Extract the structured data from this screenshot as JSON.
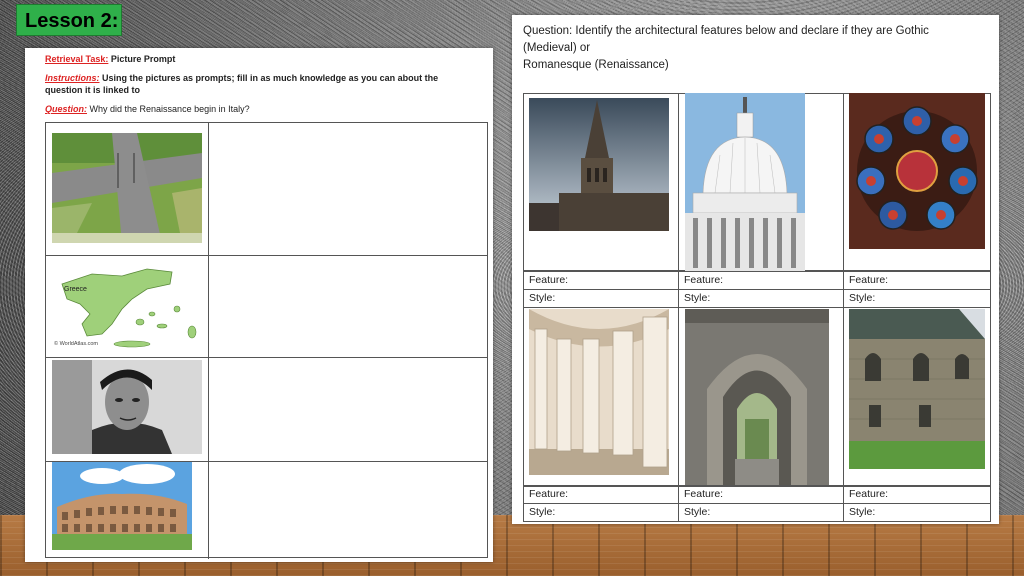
{
  "lesson_tab": {
    "label": "Lesson 2:"
  },
  "left_sheet": {
    "retrieval_label": "Retrieval Task:",
    "retrieval_value": "Picture Prompt",
    "instructions_label": "Instructions:",
    "instructions_text_1": "Using the pictures as prompts; fill in as much knowledge as you can about the",
    "instructions_text_2": "question it is linked to",
    "question_label": "Question:",
    "question_text": "Why did the Renaissance begin in Italy?",
    "map_label": "Greece",
    "map_credit": "© WorldAtlas.com"
  },
  "right_sheet": {
    "question_line_1": "Question: Identify the architectural features below and declare if they are Gothic (Medieval) or",
    "question_line_2": "Romanesque (Renaissance)",
    "feature_label": "Feature:",
    "style_label": "Style:"
  },
  "colors": {
    "lesson_green": "#2fb04a",
    "accent_red": "#d22"
  }
}
